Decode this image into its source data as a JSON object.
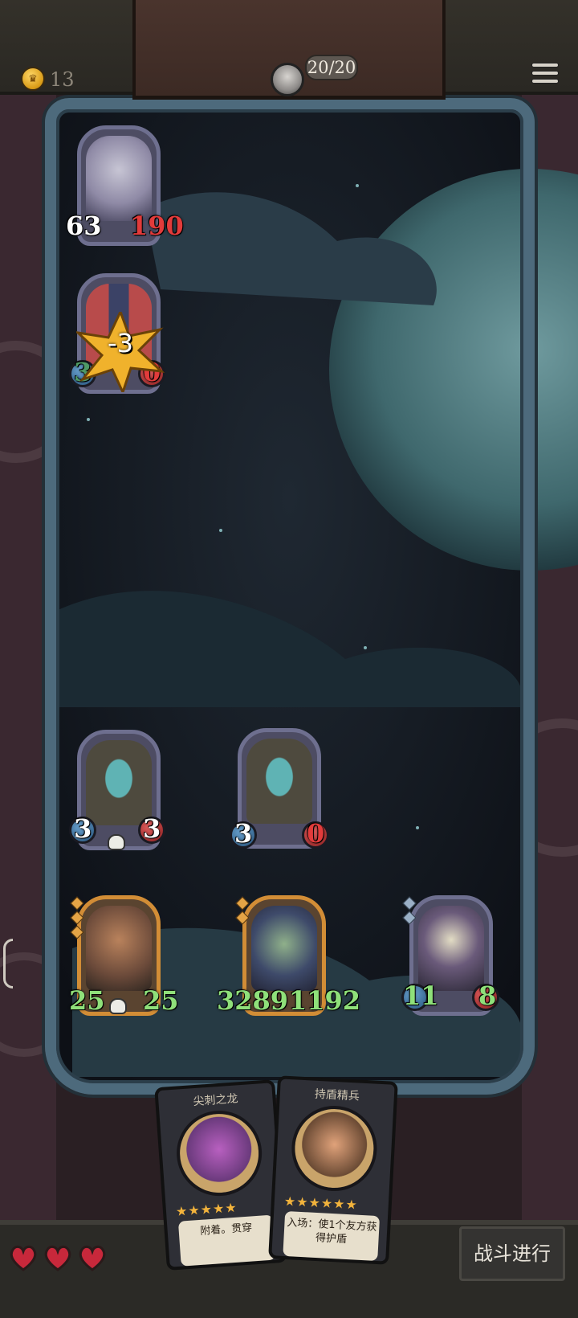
{
  "topbar": {
    "coins": "13",
    "player_hp": "20/20",
    "icons": {
      "coin": "crown-coin-icon",
      "avatar": "player-avatar",
      "menu": "menu-icon"
    }
  },
  "enemy_units": [
    {
      "attack": "63",
      "health": "190",
      "portrait": "rat-boss"
    },
    {
      "attack": "3",
      "health": "0",
      "portrait": "hooded-unit",
      "damage_popup": "-3"
    }
  ],
  "board_units": [
    {
      "attack": "3",
      "health": "3",
      "portrait": "ghost",
      "skull": true
    },
    {
      "attack": "3",
      "health": "0",
      "portrait": "ghost",
      "skull": false
    }
  ],
  "player_units": [
    {
      "attack": "25",
      "health": "25",
      "portrait": "barbarian",
      "rarity": "gold",
      "skull": true
    },
    {
      "attack": "3289",
      "health": "1192",
      "portrait": "pirate-captain",
      "rarity": "gold",
      "skull": false
    },
    {
      "attack": "11",
      "health": "8",
      "portrait": "horned-skeleton",
      "rarity": "silver",
      "skull": false
    }
  ],
  "hand_cards": [
    {
      "name": "尖刺之龙",
      "stars": "★★★★★",
      "desc": "附着。贯穿"
    },
    {
      "name": "持盾精兵",
      "stars": "★★★★★★",
      "desc": "入场：使1个友方获得护盾"
    }
  ],
  "bottom": {
    "lives": 3,
    "fight_button": "战斗进行"
  },
  "colors": {
    "attack_blue": "#4f86b8",
    "health_red": "#d13a3a",
    "buffed_green": "#8fe07a",
    "star_gold": "#f2b33c"
  }
}
